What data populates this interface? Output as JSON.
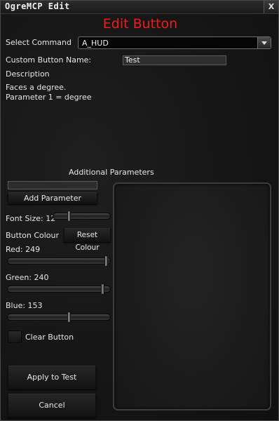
{
  "window": {
    "title": "OgreMCP Edit",
    "close_label": "X"
  },
  "heading": "Edit Button",
  "select_command": {
    "label": "Select Command",
    "value": "A_HUD"
  },
  "custom_name": {
    "label": "Custom Button Name:",
    "value": "Test"
  },
  "description": {
    "label": "Description",
    "line1": "Faces a degree.",
    "line2": "Parameter 1 = degree"
  },
  "additional_parameters": {
    "label": "Additional Parameters",
    "add_button": "Add Parameter",
    "input_value": ""
  },
  "font_size": {
    "label": "Font Size: 12",
    "value": 12,
    "min": 0,
    "max": 48
  },
  "button_colour": {
    "label": "Button Colour",
    "reset_button": "Reset Colour"
  },
  "red": {
    "label": "Red: 249",
    "value": 249
  },
  "green": {
    "label": "Green: 240",
    "value": 240
  },
  "blue": {
    "label": "Blue: 153",
    "value": 153
  },
  "clear_button": {
    "label": "Clear Button",
    "checked": false
  },
  "apply_button": "Apply to Test",
  "cancel_button": "Cancel",
  "colors": {
    "heading": "#ee1c1c",
    "background": "#141414"
  }
}
